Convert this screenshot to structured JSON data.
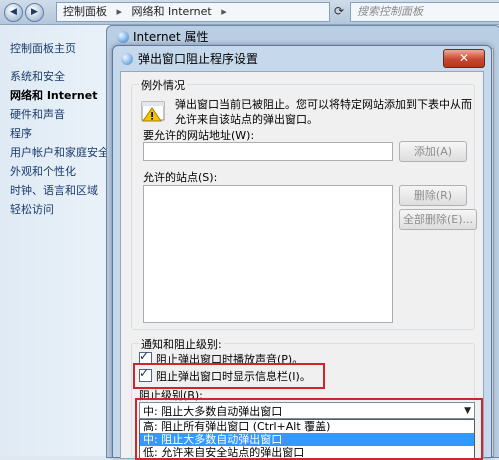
{
  "explorer": {
    "breadcrumb": [
      "控制面板",
      "网络和 Internet"
    ],
    "search_placeholder": "搜索控制面板"
  },
  "sidebar": {
    "home": "控制面板主页",
    "items": [
      "系统和安全",
      "网络和 Internet",
      "硬件和声音",
      "程序",
      "用户帐户和家庭安全",
      "外观和个性化",
      "时钟、语言和区域",
      "轻松访问"
    ],
    "selected_index": 1
  },
  "internet_properties": {
    "title": "Internet 属性"
  },
  "dialog": {
    "title": "弹出窗口阻止程序设置",
    "close_label": "✕",
    "exceptions": {
      "group_label": "例外情况",
      "info_text": "弹出窗口当前已被阻止。您可以将特定网站添加到下表中从而允许来自该站点的弹出窗口。",
      "address_label": "要允许的网站地址(W):",
      "address_value": "",
      "add_button": "添加(A)",
      "allowed_label": "允许的站点(S):",
      "allowed_sites": [],
      "delete_button": "删除(R)",
      "delete_all_button": "全部删除(E)..."
    },
    "notify": {
      "group_label": "通知和阻止级别:",
      "play_sound": {
        "label": "阻止弹出窗口时播放声音(P)。",
        "checked": true
      },
      "show_infobar": {
        "label": "阻止弹出窗口时显示信息栏(I)。",
        "checked": true
      },
      "level_label": "阻止级别(B):",
      "level_selected": "中: 阻止大多数自动弹出窗口",
      "level_options": [
        "高: 阻止所有弹出窗口 (Ctrl+Alt 覆盖)",
        "中: 阻止大多数自动弹出窗口",
        "低: 允许来自安全站点的弹出窗口"
      ],
      "highlighted_option_index": 1
    }
  },
  "colors": {
    "highlight_border": "#d0262b",
    "selection": "#3399ff"
  },
  "icons": [
    "back-icon",
    "forward-icon",
    "refresh-icon",
    "globe-icon",
    "popup-warning-icon",
    "checkbox-checked-icon",
    "dropdown-arrow-icon"
  ]
}
